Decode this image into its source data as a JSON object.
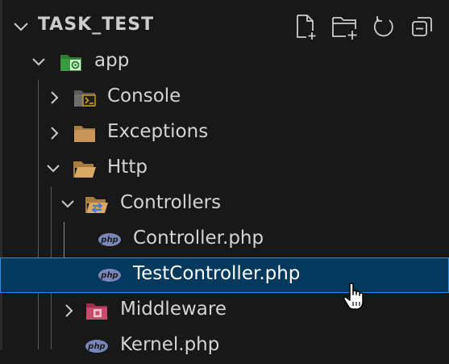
{
  "explorer": {
    "title": "TASK_TEST",
    "actions": [
      {
        "name": "new-file-icon"
      },
      {
        "name": "new-folder-icon"
      },
      {
        "name": "refresh-icon"
      },
      {
        "name": "collapse-all-icon"
      }
    ]
  },
  "tree": [
    {
      "label": "app",
      "type": "folder",
      "expanded": true,
      "icon": "app-folder-icon"
    },
    {
      "label": "Console",
      "type": "folder",
      "expanded": false,
      "icon": "console-folder-icon"
    },
    {
      "label": "Exceptions",
      "type": "folder",
      "expanded": false,
      "icon": "folder-icon"
    },
    {
      "label": "Http",
      "type": "folder",
      "expanded": true,
      "icon": "folder-open-icon"
    },
    {
      "label": "Controllers",
      "type": "folder",
      "expanded": true,
      "icon": "controllers-folder-icon"
    },
    {
      "label": "Controller.php",
      "type": "file",
      "icon": "php-file-icon"
    },
    {
      "label": "TestController.php",
      "type": "file",
      "icon": "php-file-icon",
      "selected": true
    },
    {
      "label": "Middleware",
      "type": "folder",
      "expanded": false,
      "icon": "middleware-folder-icon"
    },
    {
      "label": "Kernel.php",
      "type": "file",
      "icon": "php-file-icon"
    }
  ],
  "php_icon_text": "php",
  "colors": {
    "background": "#181818",
    "selection": "#04395e",
    "selection_border": "#2f8cda",
    "folder": "#c09553",
    "app_folder": "#3a8e3a",
    "middleware_folder": "#c94a6c"
  }
}
